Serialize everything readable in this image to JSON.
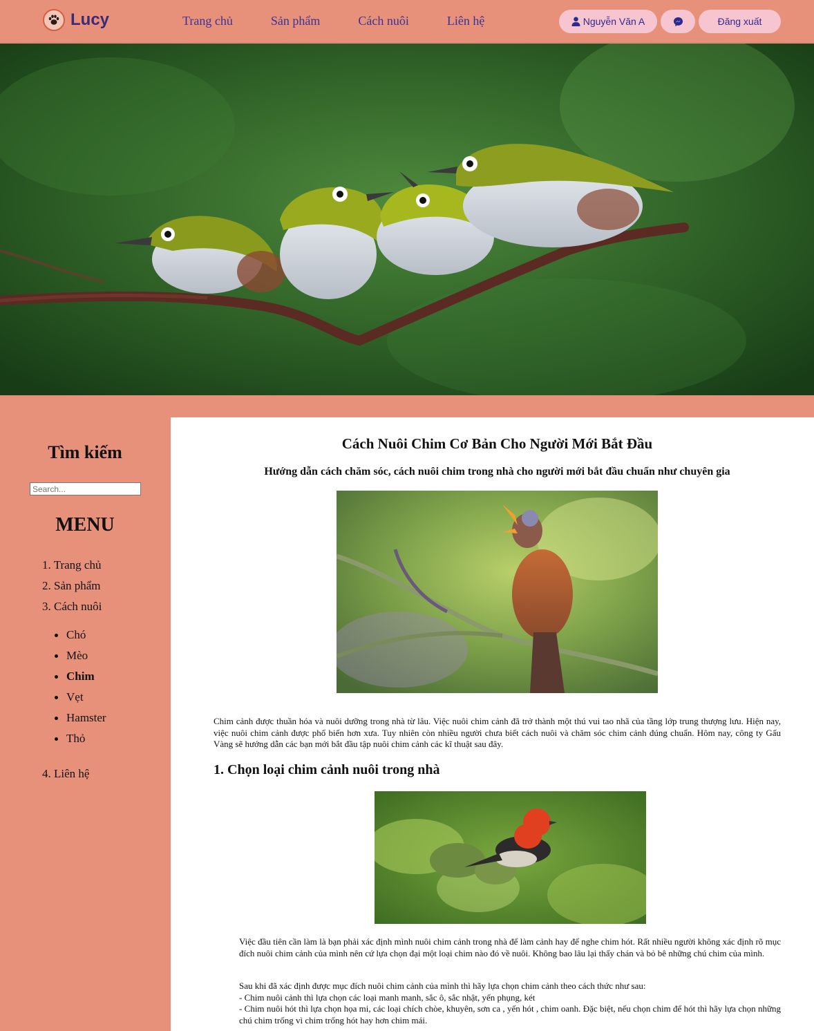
{
  "header": {
    "logo_text": "Lucy",
    "nav": [
      "Trang chủ",
      "Sản phẩm",
      "Cách nuôi",
      "Liên hệ"
    ],
    "user_name": "Nguyễn Văn A",
    "logout_label": "Đăng xuất",
    "user_icon": "user-icon",
    "messenger_icon": "messenger-icon"
  },
  "sidebar": {
    "search_title": "Tìm kiếm",
    "search_placeholder": "Search...",
    "menu_title": "MENU",
    "menu_items": [
      "1. Trang chủ",
      "2. Sản phẩm",
      "3. Cách nuôi"
    ],
    "sub_items": [
      "Chó",
      "Mèo",
      "Chim",
      "Vẹt",
      "Hamster",
      "Thỏ"
    ],
    "active_sub_item": "Chim",
    "last_item": "4. Liên hệ"
  },
  "article": {
    "title": "Cách Nuôi Chim Cơ Bản Cho Người Mới Bắt Đầu",
    "subtitle": "Hướng dẫn cách chăm sóc, cách nuôi chim trong nhà cho người mới bắt đầu chuẩn như chuyên gia",
    "intro": "Chim cảnh được thuần hóa và nuôi dưỡng trong nhà từ lâu. Việc nuôi chim cảnh đã trở thành một thú vui tao nhã của tầng lớp trung thượng lưu. Hiện nay, việc nuôi chim cảnh được phổ biến hơn xưa. Tuy nhiên còn nhiều người chưa biết cách nuôi và chăm sóc chim cảnh đúng chuẩn. Hôm nay, công ty Gấu Vàng sẽ hướng dẫn các bạn mới bắt đầu tập nuôi chim cảnh các kĩ thuật sau đây.",
    "section1_heading": "1. Chọn loại chim cảnh nuôi trong nhà",
    "section1_p1": "Việc đầu tiên cần làm là bạn phải xác định mình nuôi chim cảnh trong nhà để làm cảnh hay để nghe chim hót. Rất nhiều người không xác định rõ mục đích nuôi chim cảnh của mình nên cứ lựa chọn đại một loại chim nào đó về nuôi. Không bao lâu lại thấy chán và bỏ bê những chú chim của mình.",
    "section1_p2_intro": "Sau khi đã xác định được mục đích nuôi chim cảnh của mình thì hãy lựa chọn chim cảnh theo cách thức như sau:",
    "section1_p2_line1": "- Chim nuôi cảnh thì lựa chọn các loại manh manh, sắc ô, sắc nhật, yến phụng, két",
    "section1_p2_line2": "- Chim nuôi hót thì lựa chọn họa mi, các loại chích chòe, khuyên, sơn ca , yến hót , chim oanh. Đặc biệt, nếu chọn chim để hót thì hãy lựa chọn những chú chim trống vì chim trống hót hay hơn chim mái."
  },
  "colors": {
    "background": "#e8917a",
    "nav_text": "#3a3294",
    "pill": "#f7c5d0",
    "logo_text": "#3a2a78"
  }
}
